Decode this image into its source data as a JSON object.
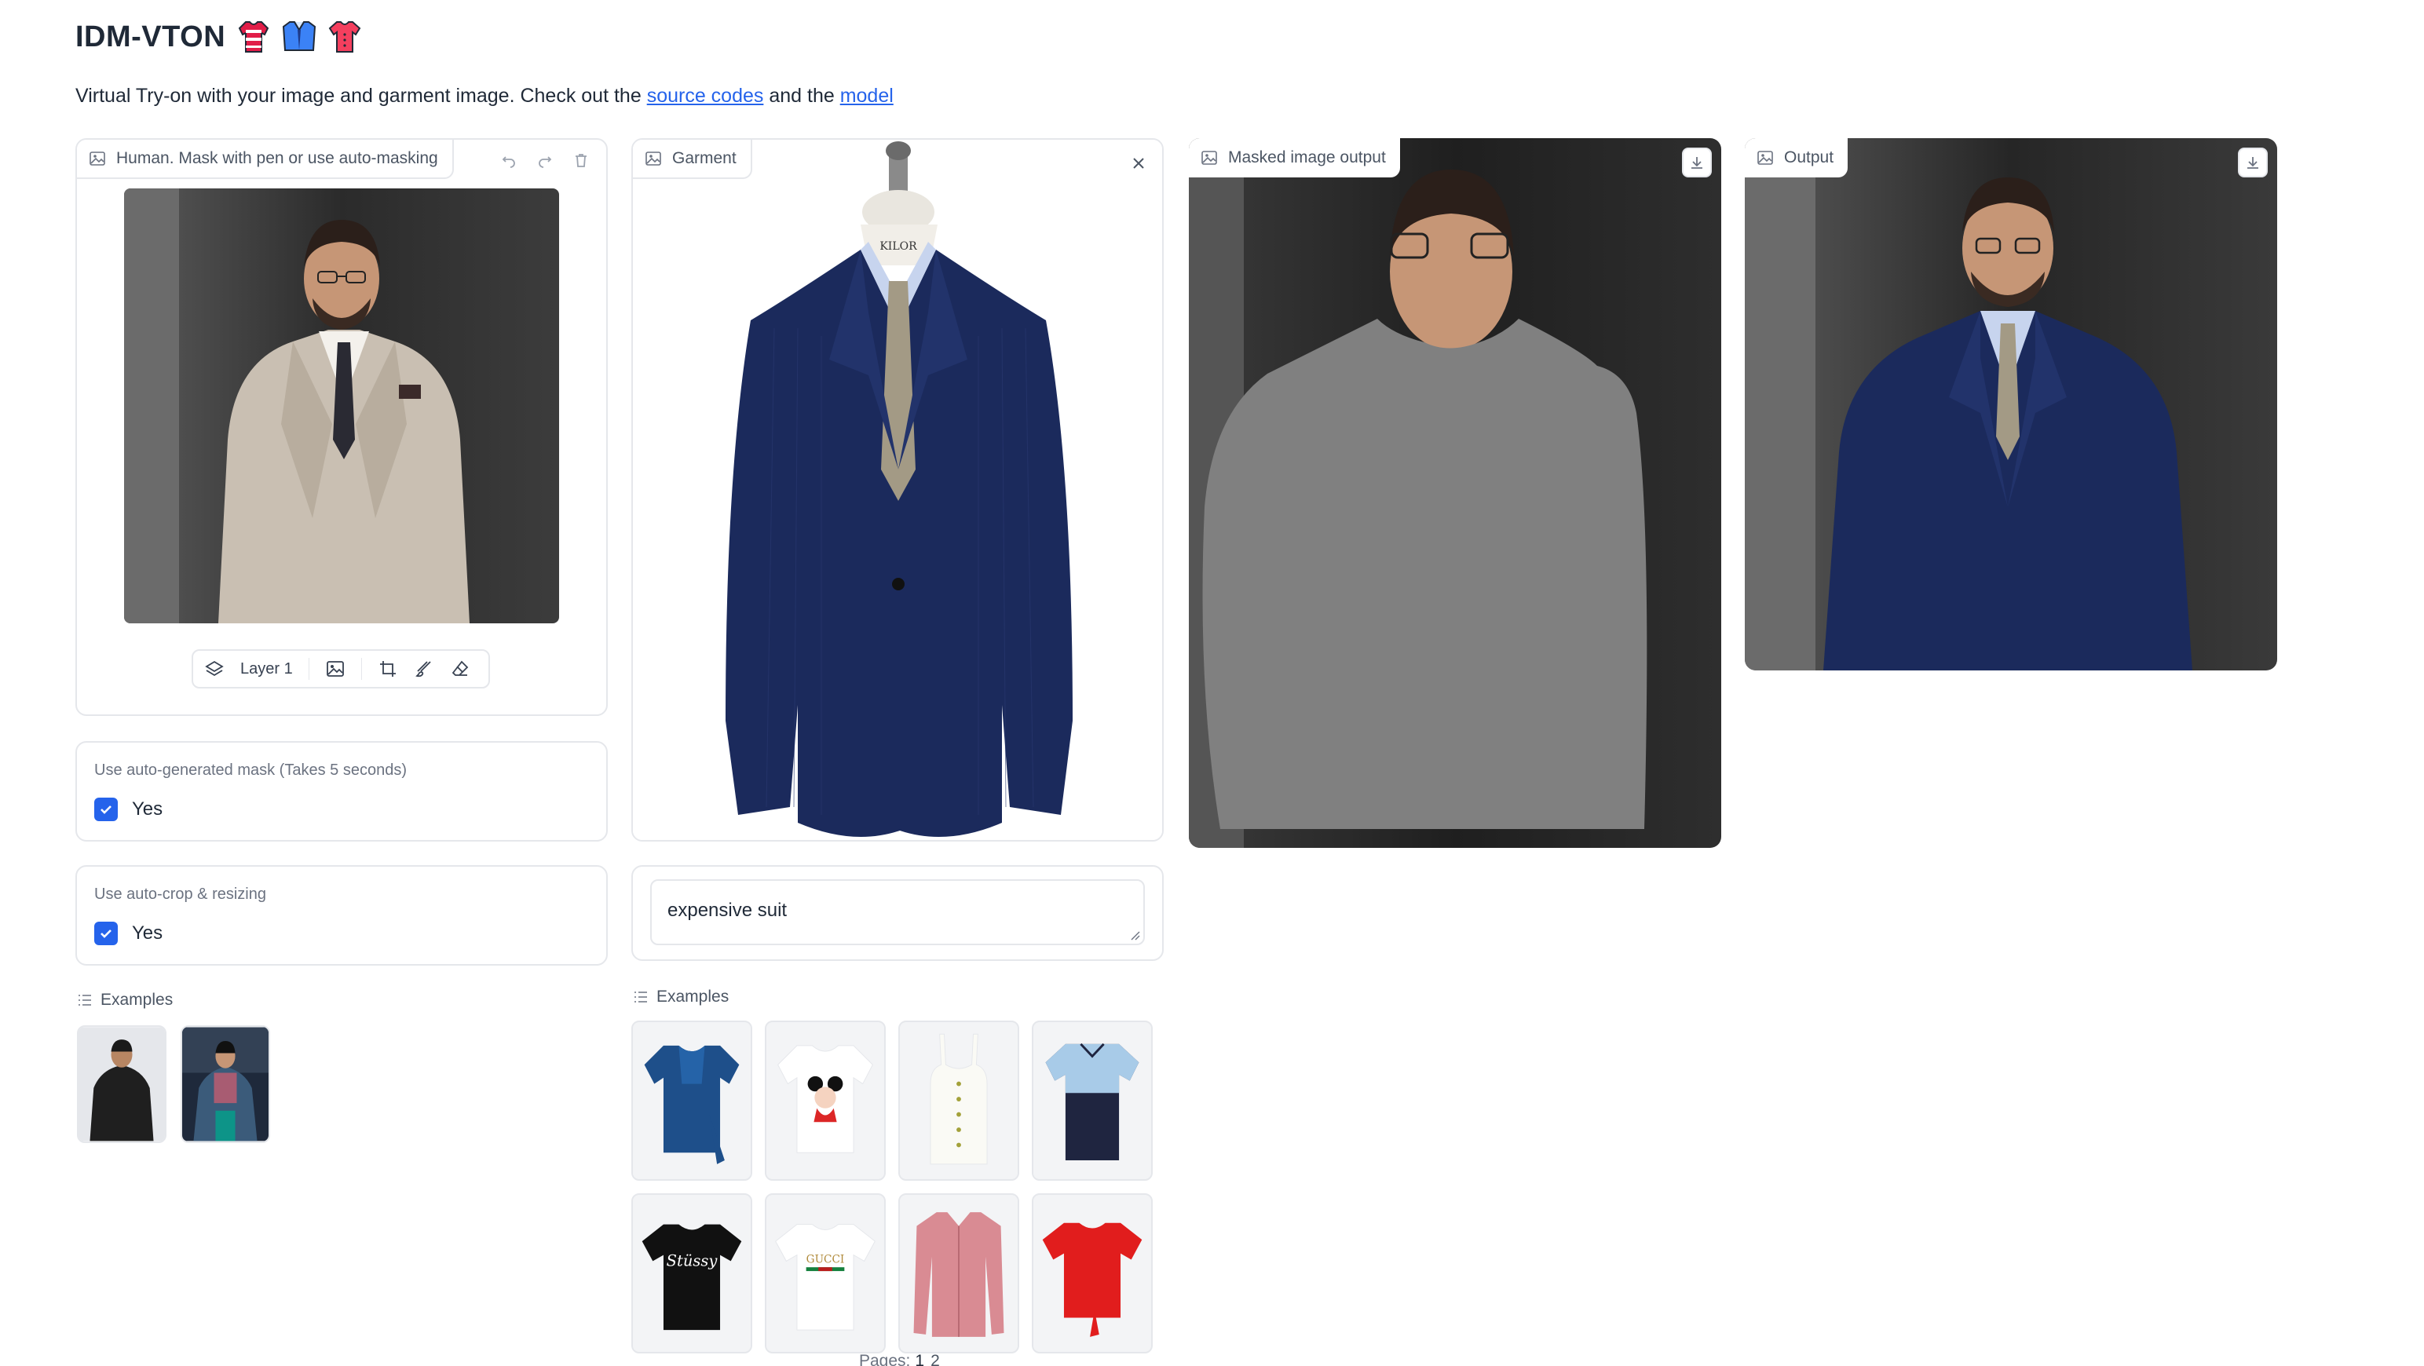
{
  "header": {
    "title": "IDM-VTON",
    "subtitle_prefix": "Virtual Try-on with your image and garment image. Check out the ",
    "link_source": "source codes",
    "subtitle_mid": " and the ",
    "link_model": "model"
  },
  "human_panel": {
    "label": "Human. Mask with pen or use auto-masking",
    "layer_label": "Layer 1"
  },
  "garment_panel": {
    "label": "Garment"
  },
  "masked_panel": {
    "label": "Masked image output"
  },
  "output_panel": {
    "label": "Output"
  },
  "options": {
    "auto_mask_label": "Use auto-generated mask (Takes 5 seconds)",
    "auto_mask_value": "Yes",
    "auto_crop_label": "Use auto-crop & resizing",
    "auto_crop_value": "Yes"
  },
  "garment_description": {
    "value": "expensive suit"
  },
  "examples": {
    "human_label": "Examples",
    "garment_label": "Examples",
    "pages_label": "Pages:",
    "page_current": "1",
    "page_next": "2"
  },
  "colors": {
    "accent": "#2563eb",
    "suit_navy": "#1b2a5c",
    "mask_gray": "#808080",
    "border": "#e5e7eb"
  }
}
